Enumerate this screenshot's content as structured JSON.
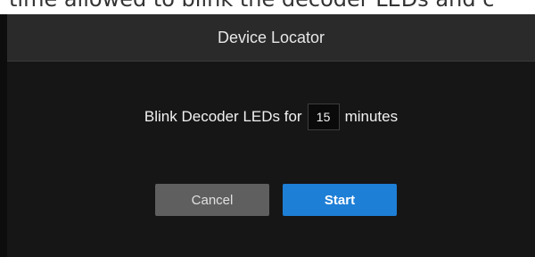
{
  "background_text": "time allowed to blink the decoder LEDs and c",
  "dialog": {
    "title": "Device Locator",
    "prompt_prefix": "Blink Decoder LEDs for",
    "minutes_value": "15",
    "prompt_suffix": "minutes",
    "cancel_label": "Cancel",
    "start_label": "Start"
  },
  "colors": {
    "header_bg": "#2a2a2a",
    "body_bg": "#161616",
    "cancel_bg": "#5f5f5f",
    "start_bg": "#1e7fd6"
  }
}
